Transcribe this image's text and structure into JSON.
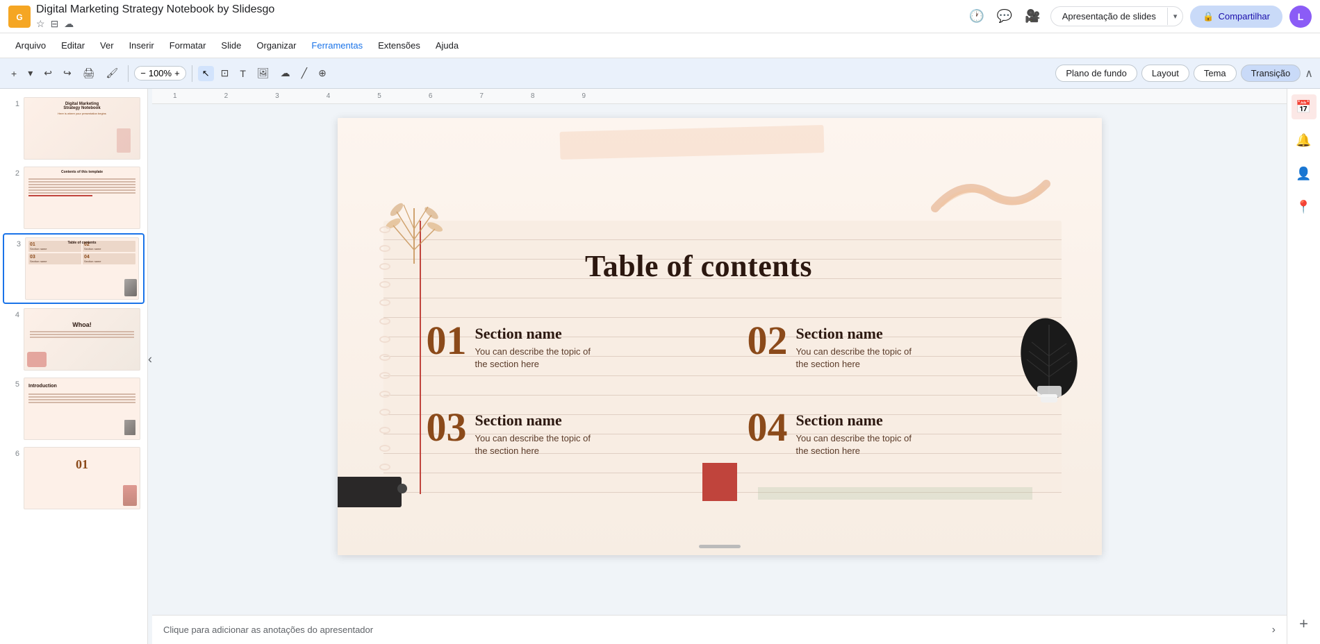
{
  "app": {
    "icon": "G",
    "title": "Digital Marketing Strategy Notebook by Slidesgo",
    "star_icon": "★",
    "folder_icon": "⊟",
    "cloud_icon": "☁"
  },
  "menu": {
    "items": [
      "Arquivo",
      "Editar",
      "Ver",
      "Inserir",
      "Formatar",
      "Slide",
      "Organizar",
      "Ferramentas",
      "Extensões",
      "Ajuda"
    ]
  },
  "top_right": {
    "history_icon": "🕐",
    "chat_icon": "💬",
    "camera_icon": "📹",
    "present_label": "Apresentação de slides",
    "dropdown_icon": "▾",
    "share_icon": "🔒",
    "share_label": "Compartilhar",
    "avatar_label": "L"
  },
  "toolbar": {
    "undo": "↩",
    "redo": "↪",
    "print": "🖨",
    "paint": "🖌",
    "zoom_out": "−",
    "zoom_in": "+",
    "zoom_level": "100%",
    "cursor_tool": "↖",
    "select_tool": "⊡",
    "image_tool": "🖼",
    "shape_tool": "☁",
    "line_tool": "╱",
    "bg_label": "Plano de fundo",
    "layout_label": "Layout",
    "theme_label": "Tema",
    "transition_label": "Transição",
    "collapse_icon": "∧"
  },
  "sidebar": {
    "slides": [
      {
        "num": "1",
        "preview_type": "title"
      },
      {
        "num": "2",
        "preview_type": "contents_list"
      },
      {
        "num": "3",
        "preview_type": "toc",
        "active": true
      },
      {
        "num": "4",
        "preview_type": "whoa"
      },
      {
        "num": "5",
        "preview_type": "introduction"
      },
      {
        "num": "6",
        "preview_type": "number_01"
      }
    ],
    "collapse_icon": "‹"
  },
  "slide": {
    "title": "Table of contents",
    "sections": [
      {
        "num": "01",
        "name": "Section name",
        "desc": "You can describe the topic of\nthe section here"
      },
      {
        "num": "02",
        "name": "Section name",
        "desc": "You can describe the topic of\nthe section here"
      },
      {
        "num": "03",
        "name": "Section name",
        "desc": "You can describe the topic of\nthe section here"
      },
      {
        "num": "04",
        "name": "Section name",
        "desc": "You can describe the topic of\nthe section here"
      }
    ]
  },
  "bottom_bar": {
    "notes_placeholder": "Clique para adicionar as anotações do apresentador"
  },
  "right_panel": {
    "calendar_icon": "📅",
    "notification_icon": "🔔",
    "person_icon": "👤",
    "map_icon": "📍",
    "plus_icon": "+"
  }
}
